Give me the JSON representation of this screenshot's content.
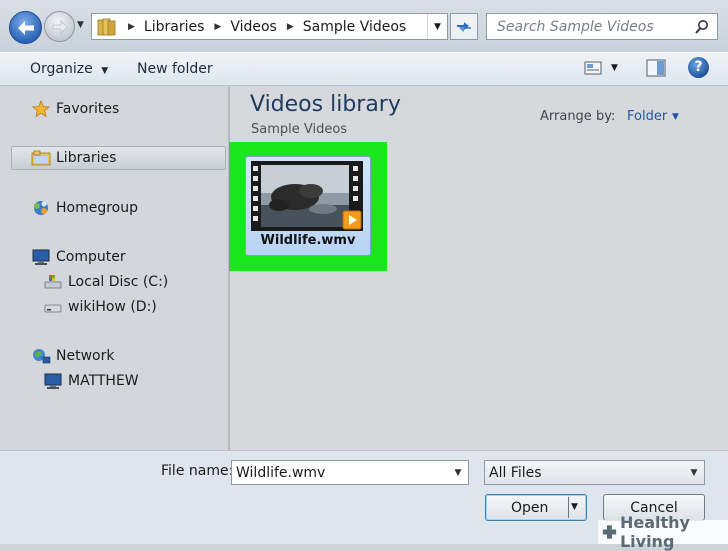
{
  "address_bar": {
    "breadcrumbs": [
      "Libraries",
      "Videos",
      "Sample Videos"
    ],
    "search_placeholder": "Search Sample Videos"
  },
  "toolbar": {
    "organize_label": "Organize",
    "new_folder_label": "New folder"
  },
  "nav_pane": {
    "favorites": "Favorites",
    "libraries": "Libraries",
    "homegroup": "Homegroup",
    "computer": "Computer",
    "local_disc": "Local Disc (C:)",
    "wikihow_drive": "wikiHow (D:)",
    "network": "Network",
    "matthew": "MATTHEW",
    "selected": "Libraries"
  },
  "content": {
    "library_title": "Videos library",
    "library_subtitle": "Sample Videos",
    "arrange_by_label": "Arrange by:",
    "arrange_by_value": "Folder",
    "files": [
      {
        "name": "Wildlife.wmv",
        "selected": true,
        "highlight_color": "#19e61d"
      }
    ]
  },
  "bottom_panel": {
    "file_name_label": "File name:",
    "file_name_value": "Wildlife.wmv",
    "file_type_value": "All Files",
    "open_label": "Open",
    "cancel_label": "Cancel"
  },
  "watermark": {
    "text": "Healthy Living"
  },
  "colors": {
    "highlight": "#19e61d",
    "link_blue": "#1f56a8",
    "title_blue": "#1e3a5f"
  }
}
